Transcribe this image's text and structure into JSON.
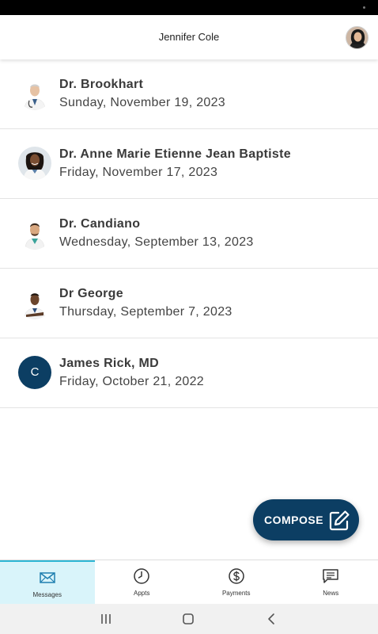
{
  "header": {
    "title": "Jennifer Cole"
  },
  "threads": [
    {
      "name": "Dr. Brookhart",
      "date": "Sunday, November 19, 2023",
      "avatar": "doctor-photo-older-man"
    },
    {
      "name": "Dr. Anne Marie Etienne Jean Baptiste",
      "date": "Friday, November 17, 2023",
      "avatar": "doctor-photo-woman"
    },
    {
      "name": "Dr. Candiano",
      "date": "Wednesday, September 13, 2023",
      "avatar": "doctor-photo-man"
    },
    {
      "name": "Dr George",
      "date": "Thursday, September 7, 2023",
      "avatar": "doctor-photo-man-arms-crossed"
    },
    {
      "name": "James Rick, MD",
      "date": "Friday, October 21, 2022",
      "avatar_initial": "C"
    }
  ],
  "compose": {
    "label": "COMPOSE",
    "icon": "edit-icon"
  },
  "bottom_nav": [
    {
      "label": "Messages",
      "icon": "envelope-icon",
      "active": true
    },
    {
      "label": "Appts",
      "icon": "clock-icon",
      "active": false
    },
    {
      "label": "Payments",
      "icon": "dollar-icon",
      "active": false
    },
    {
      "label": "News",
      "icon": "chat-icon",
      "active": false
    }
  ],
  "colors": {
    "primary": "#0c3e63",
    "active_tab_bg": "#d9f4fa",
    "active_tab_accent": "#2cb6d4"
  }
}
